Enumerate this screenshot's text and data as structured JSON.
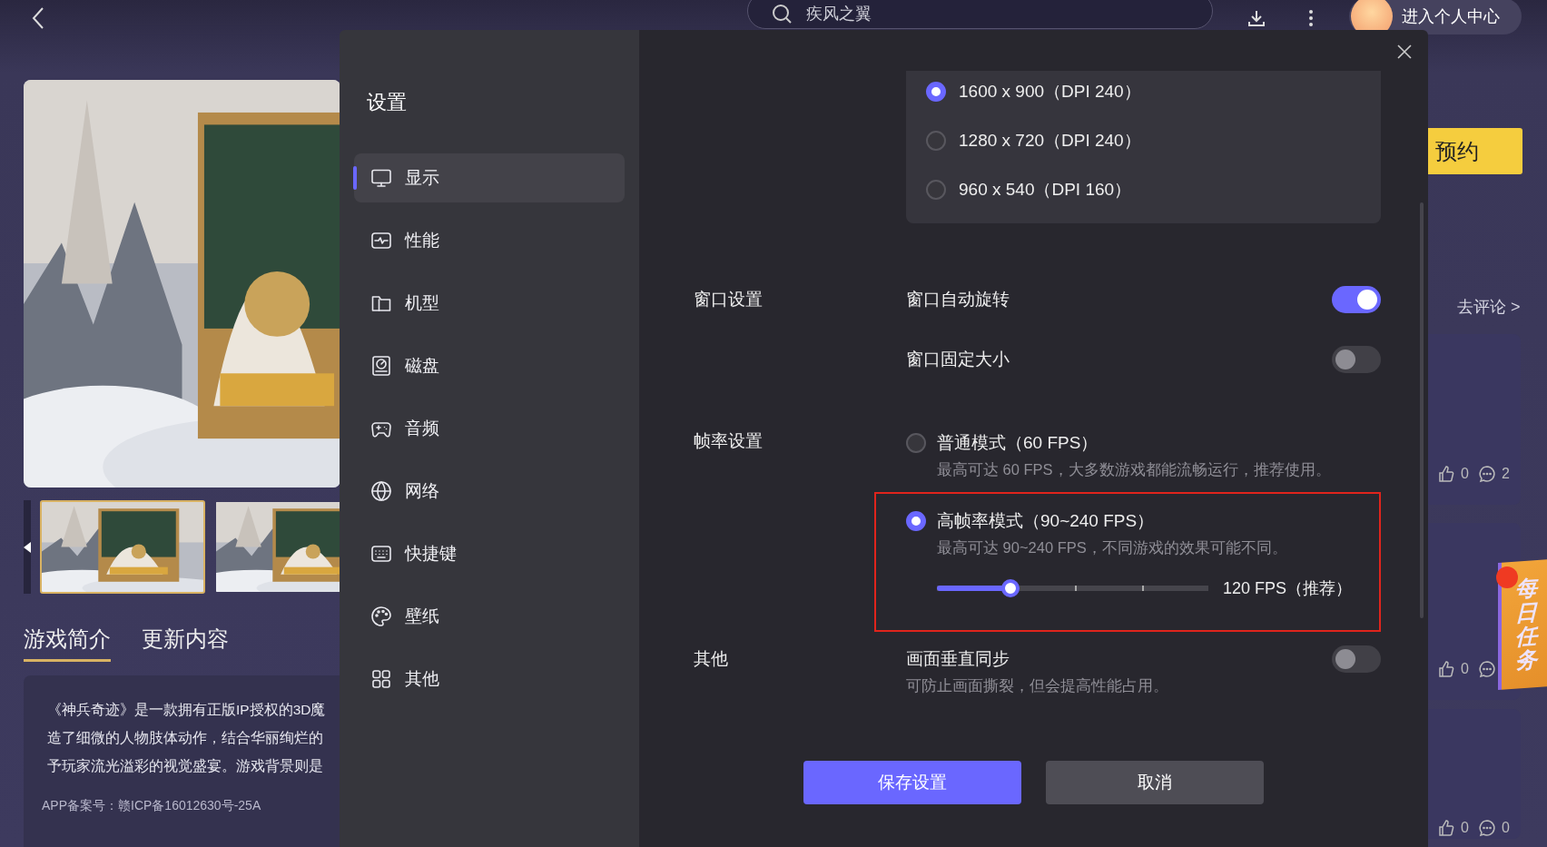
{
  "top_bar": {
    "search": {
      "value": "疾风之翼"
    },
    "profile_label": "进入个人中心"
  },
  "game": {
    "thumbnails": [
      {
        "selected": true
      },
      {
        "selected": false
      }
    ],
    "tabs": [
      {
        "label": "游戏简介",
        "selected": true
      },
      {
        "label": "更新内容",
        "selected": false
      }
    ],
    "description_lines": [
      "《神兵奇迹》是一款拥有正版IP授权的3D魔",
      "造了细微的人物肢体动作，结合华丽绚烂的",
      "予玩家流光溢彩的视觉盛宴。游戏背景则是"
    ],
    "record_number": "APP备案号：赣ICP备16012630号-25A"
  },
  "right_panel": {
    "reserve_button": "预约",
    "comment_link": "去评论 >",
    "reviews": [
      {
        "likes": "0",
        "comments": "2"
      },
      {
        "likes": "0"
      },
      {
        "likes": "0",
        "comments": "0"
      }
    ],
    "daily_task": "每日任务"
  },
  "settings": {
    "title": "设置",
    "nav": [
      {
        "label": "显示",
        "selected": true
      },
      {
        "label": "性能",
        "selected": false
      },
      {
        "label": "机型",
        "selected": false
      },
      {
        "label": "磁盘",
        "selected": false
      },
      {
        "label": "音频",
        "selected": false
      },
      {
        "label": "网络",
        "selected": false
      },
      {
        "label": "快捷键",
        "selected": false
      },
      {
        "label": "壁纸",
        "selected": false
      },
      {
        "label": "其他",
        "selected": false
      }
    ],
    "resolutions": [
      {
        "label": "1600 x 900（DPI 240）",
        "selected": true
      },
      {
        "label": "1280 x 720（DPI 240）",
        "selected": false
      },
      {
        "label": "960 x 540（DPI 160）",
        "selected": false
      }
    ],
    "sections": [
      {
        "label": "窗口设置",
        "rows": [
          {
            "kind": "toggle",
            "label": "窗口自动旋转",
            "on": true
          },
          {
            "kind": "toggle",
            "label": "窗口固定大小",
            "on": false
          }
        ]
      },
      {
        "label": "帧率设置",
        "rows": [
          {
            "kind": "radio",
            "label": "普通模式（60 FPS）",
            "description": "最高可达 60 FPS，大多数游戏都能流畅运行，推荐使用。",
            "selected": false
          },
          {
            "kind": "radio",
            "label": "高帧率模式（90~240 FPS）",
            "description": "最高可达 90~240 FPS，不同游戏的效果可能不同。",
            "selected": true,
            "highlighted": true,
            "slider": {
              "level": 0.27,
              "reading": "120 FPS（推荐）"
            }
          }
        ]
      },
      {
        "label": "其他",
        "rows": [
          {
            "kind": "toggle",
            "label": "画面垂直同步",
            "description": "可防止画面撕裂，但会提高性能占用。",
            "on": false
          }
        ]
      }
    ],
    "buttons": {
      "save": "保存设置",
      "cancel": "取消"
    }
  }
}
